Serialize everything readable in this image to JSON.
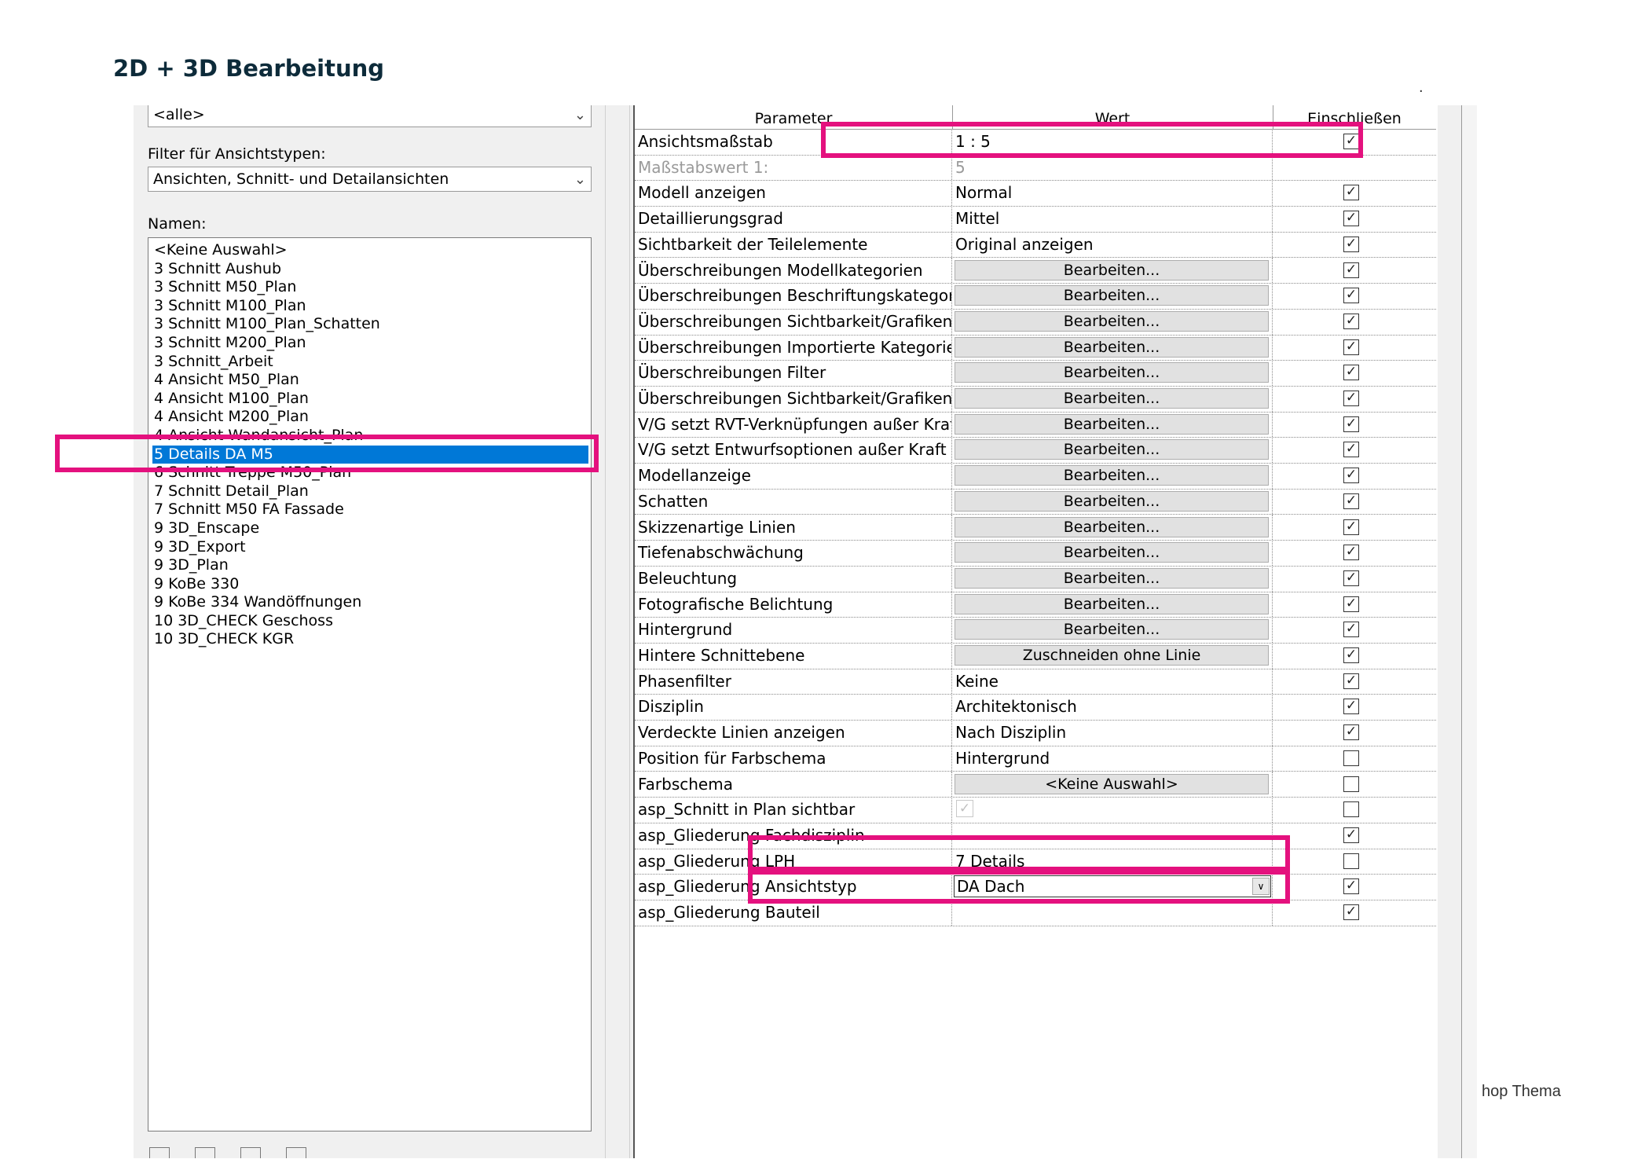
{
  "slide": {
    "title": "2D + 3D Bearbeitung",
    "footer_fragment": "hop Thema",
    "stray_mark": "."
  },
  "left_panel": {
    "category_combo_value": "<alle>",
    "view_type_filter_label": "Filter für Ansichtstypen:",
    "view_type_filter_value": "Ansichten, Schnitt- und Detailansichten",
    "names_label": "Namen:",
    "names": [
      "<Keine Auswahl>",
      "3 Schnitt Aushub",
      "3 Schnitt M50_Plan",
      "3 Schnitt M100_Plan",
      "3 Schnitt M100_Plan_Schatten",
      "3 Schnitt M200_Plan",
      "3 Schnitt_Arbeit",
      "4 Ansicht M50_Plan",
      "4 Ansicht M100_Plan",
      "4 Ansicht M200_Plan",
      "4 Ansicht Wandansicht_Plan",
      "5 Details DA M5",
      "6 Schnitt Treppe M50_Plan",
      "7 Schnitt Detail_Plan",
      "7 Schnitt M50 FA Fassade",
      "9 3D_Enscape",
      "9 3D_Export",
      "9 3D_Plan",
      "9 KoBe 330",
      "9 KoBe 334 Wandöffnungen",
      "10 3D_CHECK Geschoss",
      "10 3D_CHECK KGR"
    ],
    "selected_name": "5 Details DA M5"
  },
  "table": {
    "headers": {
      "parameter": "Parameter",
      "value": "Wert",
      "include": "Einschließen"
    },
    "rows": [
      {
        "param": "Ansichtsmaßstab",
        "value": "1 : 5",
        "kind": "text",
        "checked": true
      },
      {
        "param": "Maßstabswert 1:",
        "value": "5",
        "kind": "text",
        "checked": null,
        "dim": true
      },
      {
        "param": "Modell anzeigen",
        "value": "Normal",
        "kind": "text",
        "checked": true
      },
      {
        "param": "Detaillierungsgrad",
        "value": "Mittel",
        "kind": "text",
        "checked": true
      },
      {
        "param": "Sichtbarkeit der Teilelemente",
        "value": "Original anzeigen",
        "kind": "text",
        "checked": true
      },
      {
        "param": "Überschreibungen Modellkategorien",
        "value": "Bearbeiten...",
        "kind": "button",
        "checked": true
      },
      {
        "param": "Überschreibungen Beschriftungskategorie",
        "value": "Bearbeiten...",
        "kind": "button",
        "checked": true
      },
      {
        "param": "Überschreibungen Sichtbarkeit/Grafiken:",
        "value": "Bearbeiten...",
        "kind": "button",
        "checked": true
      },
      {
        "param": "Überschreibungen Importierte Kategorien",
        "value": "Bearbeiten...",
        "kind": "button",
        "checked": true
      },
      {
        "param": "Überschreibungen Filter",
        "value": "Bearbeiten...",
        "kind": "button",
        "checked": true
      },
      {
        "param": "Überschreibungen Sichtbarkeit/Grafiken:",
        "value": "Bearbeiten...",
        "kind": "button",
        "checked": true
      },
      {
        "param": "V/G setzt RVT-Verknüpfungen außer Kraft",
        "value": "Bearbeiten...",
        "kind": "button",
        "checked": true
      },
      {
        "param": "V/G setzt Entwurfsoptionen außer Kraft",
        "value": "Bearbeiten...",
        "kind": "button",
        "checked": true
      },
      {
        "param": "Modellanzeige",
        "value": "Bearbeiten...",
        "kind": "button",
        "checked": true
      },
      {
        "param": "Schatten",
        "value": "Bearbeiten...",
        "kind": "button",
        "checked": true
      },
      {
        "param": "Skizzenartige Linien",
        "value": "Bearbeiten...",
        "kind": "button",
        "checked": true
      },
      {
        "param": "Tiefenabschwächung",
        "value": "Bearbeiten...",
        "kind": "button",
        "checked": true
      },
      {
        "param": "Beleuchtung",
        "value": "Bearbeiten...",
        "kind": "button",
        "checked": true
      },
      {
        "param": "Fotografische Belichtung",
        "value": "Bearbeiten...",
        "kind": "button",
        "checked": true
      },
      {
        "param": "Hintergrund",
        "value": "Bearbeiten...",
        "kind": "button",
        "checked": true
      },
      {
        "param": "Hintere Schnittebene",
        "value": "Zuschneiden ohne Linie",
        "kind": "button",
        "checked": true
      },
      {
        "param": "Phasenfilter",
        "value": "Keine",
        "kind": "text",
        "checked": true
      },
      {
        "param": "Disziplin",
        "value": "Architektonisch",
        "kind": "text",
        "checked": true
      },
      {
        "param": "Verdeckte Linien anzeigen",
        "value": "Nach Disziplin",
        "kind": "text",
        "checked": true
      },
      {
        "param": "Position für Farbschema",
        "value": "Hintergrund",
        "kind": "text",
        "checked": false
      },
      {
        "param": "Farbschema",
        "value": "<Keine Auswahl>",
        "kind": "button",
        "checked": false
      },
      {
        "param": "asp_Schnitt in Plan sichtbar",
        "value": "",
        "kind": "greycheck",
        "checked": false
      },
      {
        "param": "asp_Gliederung Fachdisziplin",
        "value": "",
        "kind": "text",
        "checked": true
      },
      {
        "param": "asp_Gliederung LPH",
        "value": "7 Details",
        "kind": "text",
        "checked": false
      },
      {
        "param": "asp_Gliederung Ansichtstyp",
        "value": "DA Dach",
        "kind": "dropdown",
        "checked": true
      },
      {
        "param": "asp_Gliederung Bauteil",
        "value": "",
        "kind": "text",
        "checked": true
      }
    ]
  },
  "colors": {
    "highlight": "#e4117e",
    "selection": "#0078d7",
    "title": "#0d2b3a"
  },
  "icons": {
    "checkbox": "check-mark",
    "dropdown": "chevron-down-icon"
  }
}
